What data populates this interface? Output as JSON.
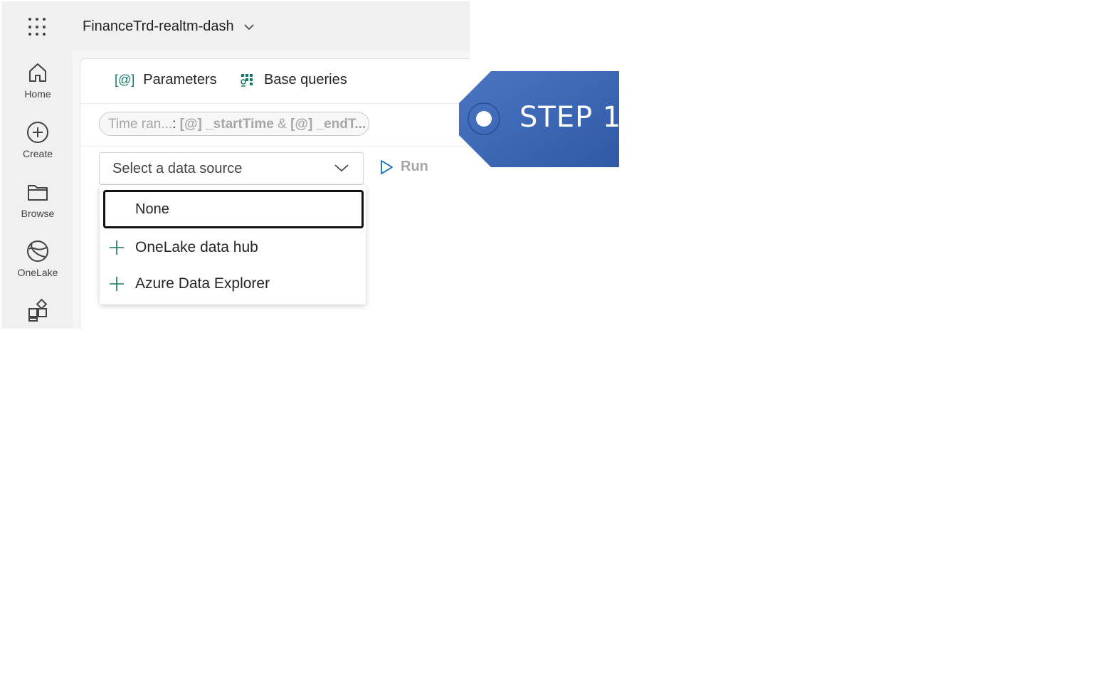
{
  "header": {
    "workspace_title": "FinanceTrd-realtm-dash",
    "icons": [
      "app-launcher-icon",
      "chevron-down-icon"
    ]
  },
  "rail": {
    "items": [
      {
        "label": "Home",
        "icon": "home-icon"
      },
      {
        "label": "Create",
        "icon": "create-plus-icon"
      },
      {
        "label": "Browse",
        "icon": "folder-icon"
      },
      {
        "label": "OneLake",
        "icon": "onelake-icon"
      },
      {
        "label": "",
        "icon": "apps-icon"
      }
    ]
  },
  "tabs": [
    {
      "label": "Parameters",
      "icon": "parameters-icon",
      "icon_text": "[@]"
    },
    {
      "label": "Base queries",
      "icon": "base-queries-icon"
    }
  ],
  "parameter_pill": {
    "label": "Time ran...",
    "separator": ":",
    "value1": "[@] _startTime",
    "joiner": "&",
    "value2": "[@] _endT..."
  },
  "data_source_select": {
    "placeholder": "Select a data source"
  },
  "run_button": {
    "label": "Run"
  },
  "dropdown": {
    "selected_option": "None",
    "options": [
      {
        "label": "OneLake data hub",
        "icon": "plus-icon"
      },
      {
        "label": "Azure Data Explorer",
        "icon": "plus-icon"
      }
    ]
  },
  "callout": {
    "label": "STEP 1",
    "color": "#3a63b0"
  },
  "colors": {
    "accent_teal": "#117865",
    "run_blue": "#0f6cbd"
  }
}
